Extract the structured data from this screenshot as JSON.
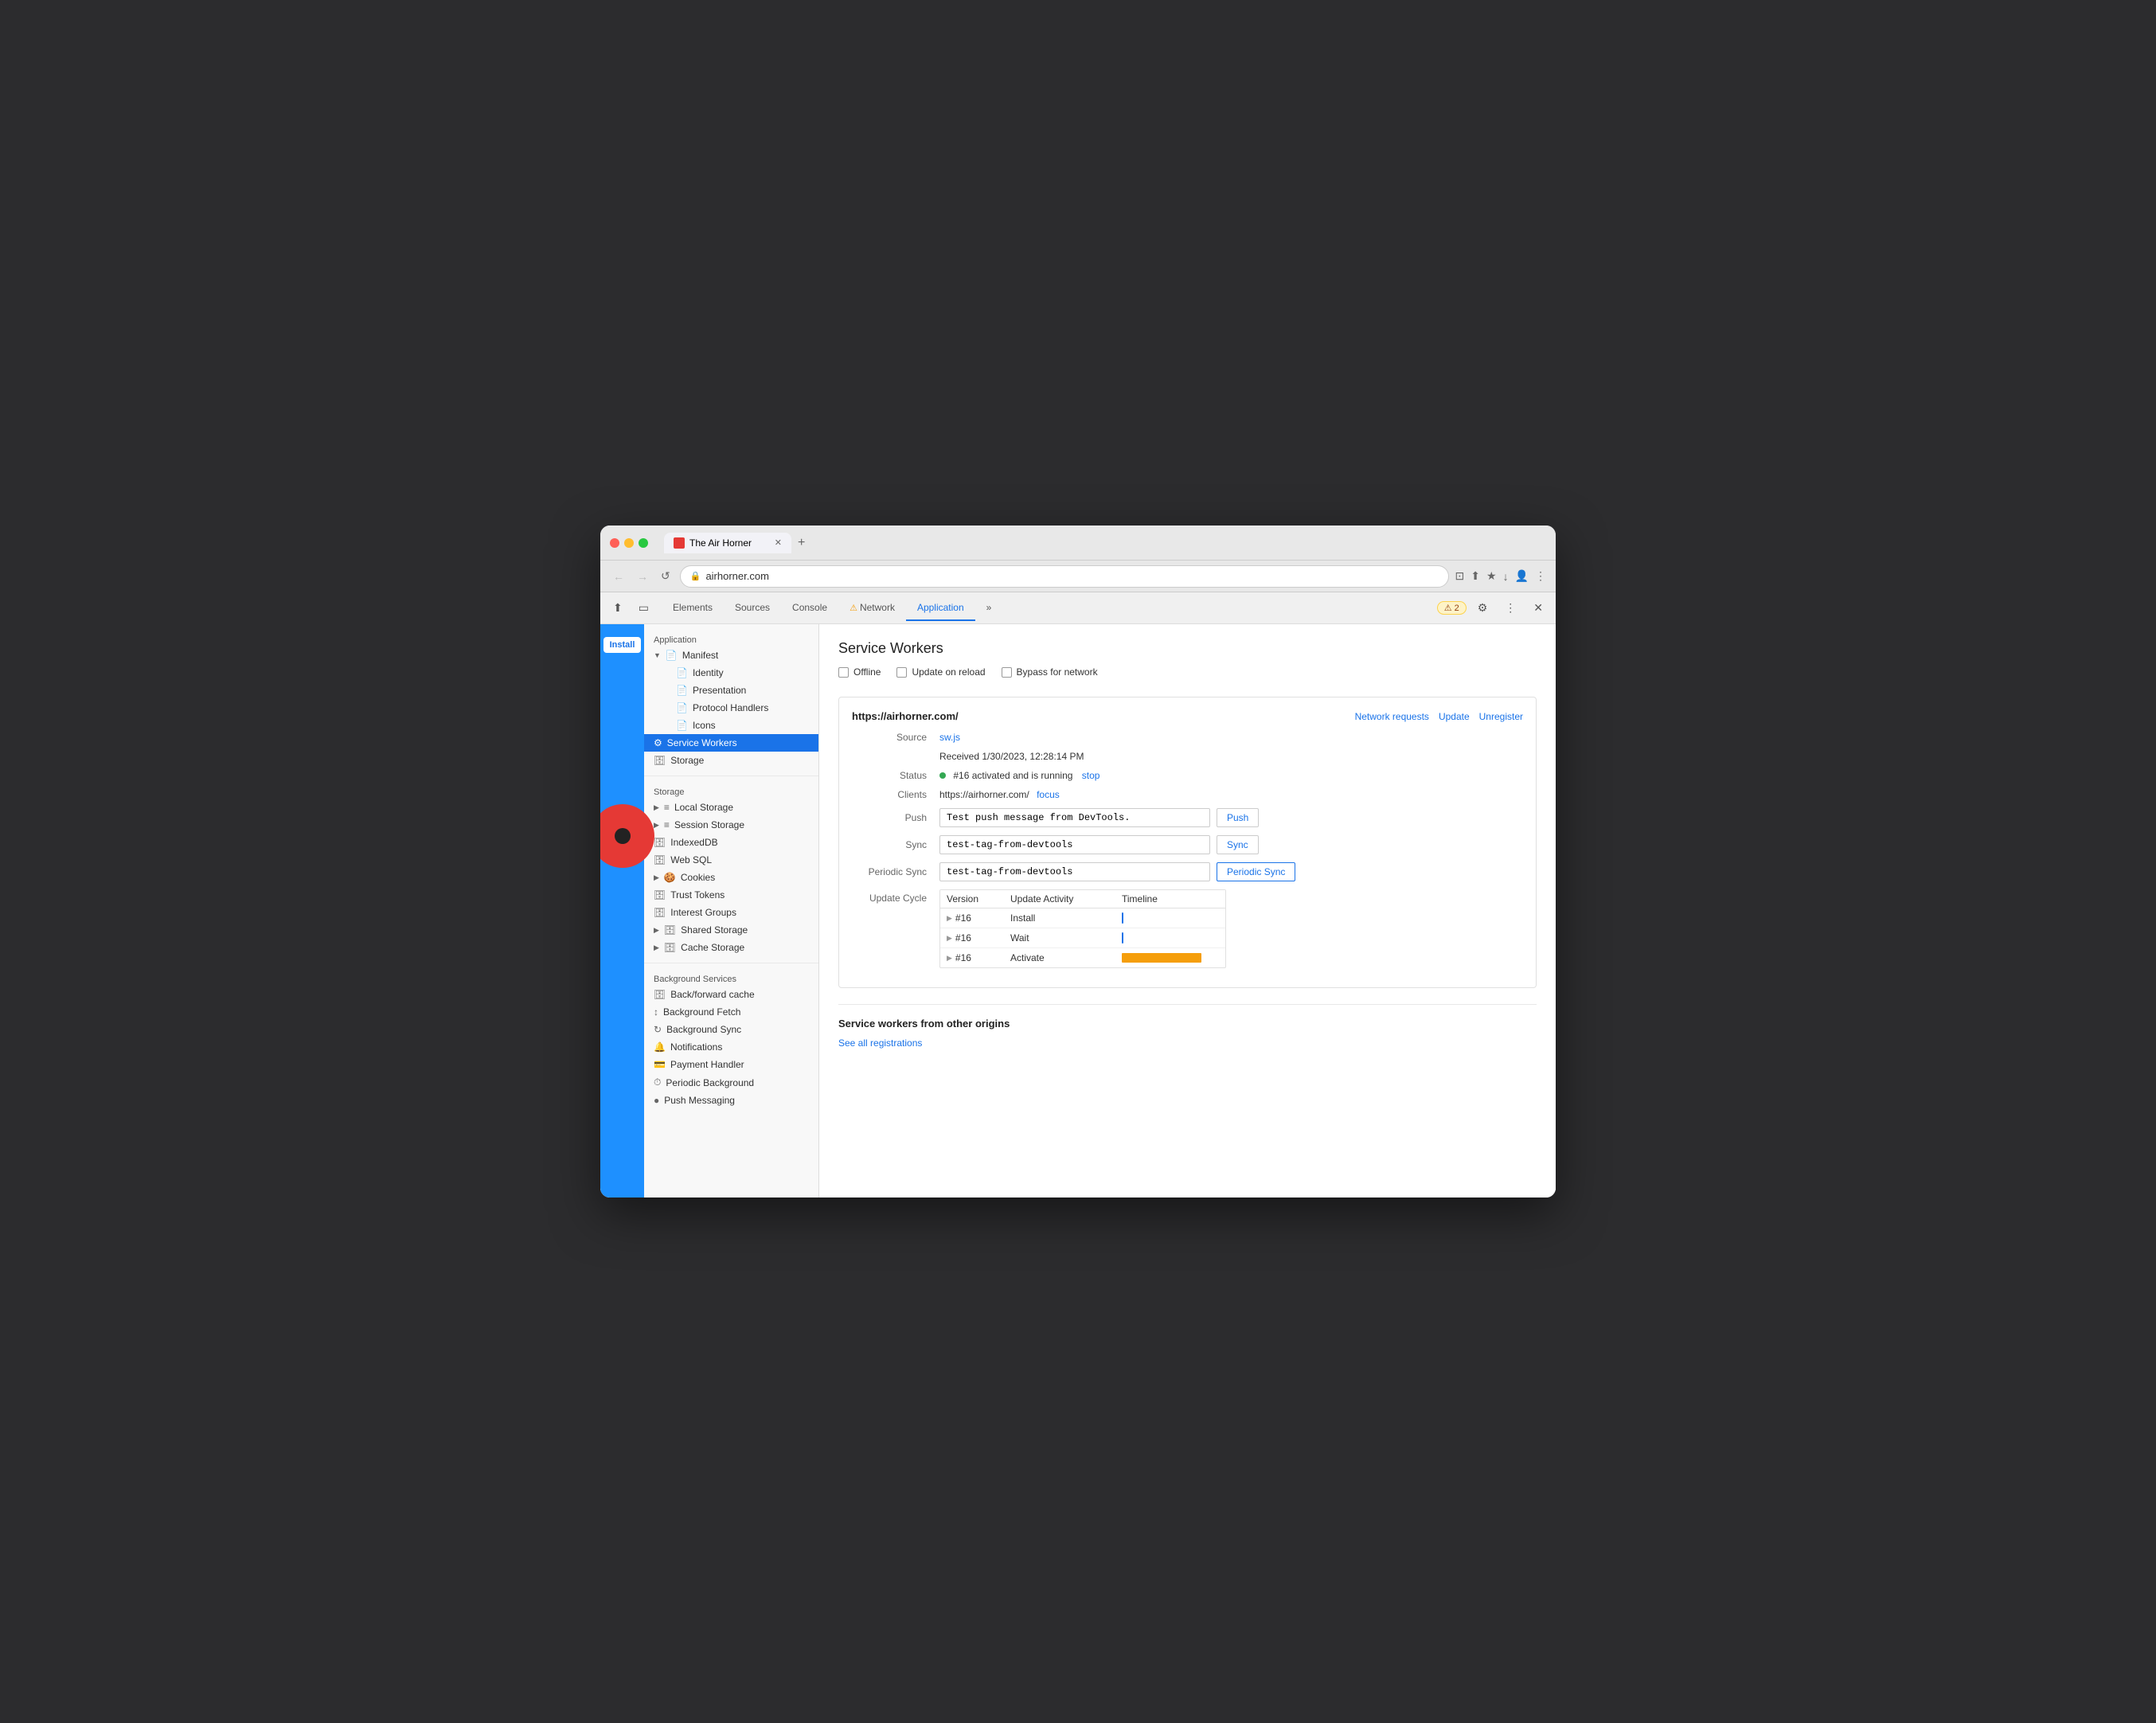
{
  "window": {
    "title": "The Air Horner",
    "url": "airhorner.com"
  },
  "browser": {
    "tabs": [
      {
        "label": "The Air Horner",
        "active": true
      }
    ],
    "new_tab_label": "+",
    "nav": {
      "back": "←",
      "forward": "→",
      "refresh": "↺"
    }
  },
  "devtools": {
    "toolbar_tabs": [
      {
        "label": "Elements",
        "active": false
      },
      {
        "label": "Sources",
        "active": false
      },
      {
        "label": "Console",
        "active": false
      },
      {
        "label": "Network",
        "active": false,
        "warning": true
      },
      {
        "label": "Application",
        "active": true
      },
      {
        "label": "»",
        "active": false
      }
    ],
    "warning_badge": "⚠ 2",
    "icons": {
      "cursor": "⬆",
      "device": "▭",
      "settings": "⚙",
      "more": "⋮",
      "close": "✕"
    }
  },
  "install_btn": "Install",
  "sidebar": {
    "application_section": "Application",
    "items": [
      {
        "label": "Manifest",
        "icon": "▼",
        "has_arrow": true,
        "indent": 0
      },
      {
        "label": "Identity",
        "icon": "📄",
        "indent": 1
      },
      {
        "label": "Presentation",
        "icon": "📄",
        "indent": 1
      },
      {
        "label": "Protocol Handlers",
        "icon": "📄",
        "indent": 1
      },
      {
        "label": "Icons",
        "icon": "📄",
        "indent": 1
      },
      {
        "label": "Service Workers",
        "icon": "⚙",
        "indent": 0,
        "active": true
      },
      {
        "label": "Storage",
        "icon": "🗄",
        "indent": 0
      }
    ],
    "storage_section": "Storage",
    "storage_items": [
      {
        "label": "Local Storage",
        "icon": "≡",
        "has_arrow": true
      },
      {
        "label": "Session Storage",
        "icon": "≡",
        "has_arrow": true
      },
      {
        "label": "IndexedDB",
        "icon": "🗄"
      },
      {
        "label": "Web SQL",
        "icon": "🗄"
      },
      {
        "label": "Cookies",
        "icon": "🍪",
        "has_arrow": true
      },
      {
        "label": "Trust Tokens",
        "icon": "🗄"
      },
      {
        "label": "Interest Groups",
        "icon": "🗄"
      },
      {
        "label": "Shared Storage",
        "icon": "🗄",
        "has_arrow": true
      },
      {
        "label": "Cache Storage",
        "icon": "🗄",
        "has_arrow": true
      }
    ],
    "bg_section": "Background Services",
    "bg_items": [
      {
        "label": "Back/forward cache",
        "icon": "🗄"
      },
      {
        "label": "Background Fetch",
        "icon": "↕"
      },
      {
        "label": "Background Sync",
        "icon": "↻"
      },
      {
        "label": "Notifications",
        "icon": "🔔"
      },
      {
        "label": "Payment Handler",
        "icon": "💳"
      },
      {
        "label": "Periodic Background",
        "icon": "⏱"
      },
      {
        "label": "Push Messaging",
        "icon": "●"
      }
    ]
  },
  "service_workers": {
    "title": "Service Workers",
    "checkboxes": [
      {
        "label": "Offline",
        "checked": false
      },
      {
        "label": "Update on reload",
        "checked": false
      },
      {
        "label": "Bypass for network",
        "checked": false
      }
    ],
    "entry": {
      "origin": "https://airhorner.com/",
      "links": {
        "network_requests": "Network requests",
        "update": "Update",
        "unregister": "Unregister"
      },
      "source_label": "Source",
      "source_file": "sw.js",
      "received_label": "",
      "received_value": "Received 1/30/2023, 12:28:14 PM",
      "status_label": "Status",
      "status_text": "#16 activated and is running",
      "stop_label": "stop",
      "clients_label": "Clients",
      "clients_value": "https://airhorner.com/",
      "focus_label": "focus",
      "push_label": "Push",
      "push_value": "Test push message from DevTools.",
      "push_btn": "Push",
      "sync_label": "Sync",
      "sync_value": "test-tag-from-devtools",
      "sync_btn": "Sync",
      "periodic_sync_label": "Periodic Sync",
      "periodic_sync_value": "test-tag-from-devtools",
      "periodic_sync_btn": "Periodic Sync",
      "update_cycle_label": "Update Cycle",
      "update_table": {
        "headers": [
          "Version",
          "Update Activity",
          "Timeline"
        ],
        "rows": [
          {
            "version": "#16",
            "activity": "Install",
            "timeline_type": "dot"
          },
          {
            "version": "#16",
            "activity": "Wait",
            "timeline_type": "dot"
          },
          {
            "version": "#16",
            "activity": "Activate",
            "timeline_type": "bar"
          }
        ]
      }
    },
    "other_origins": {
      "title": "Service workers from other origins",
      "see_all_label": "See all registrations"
    }
  }
}
